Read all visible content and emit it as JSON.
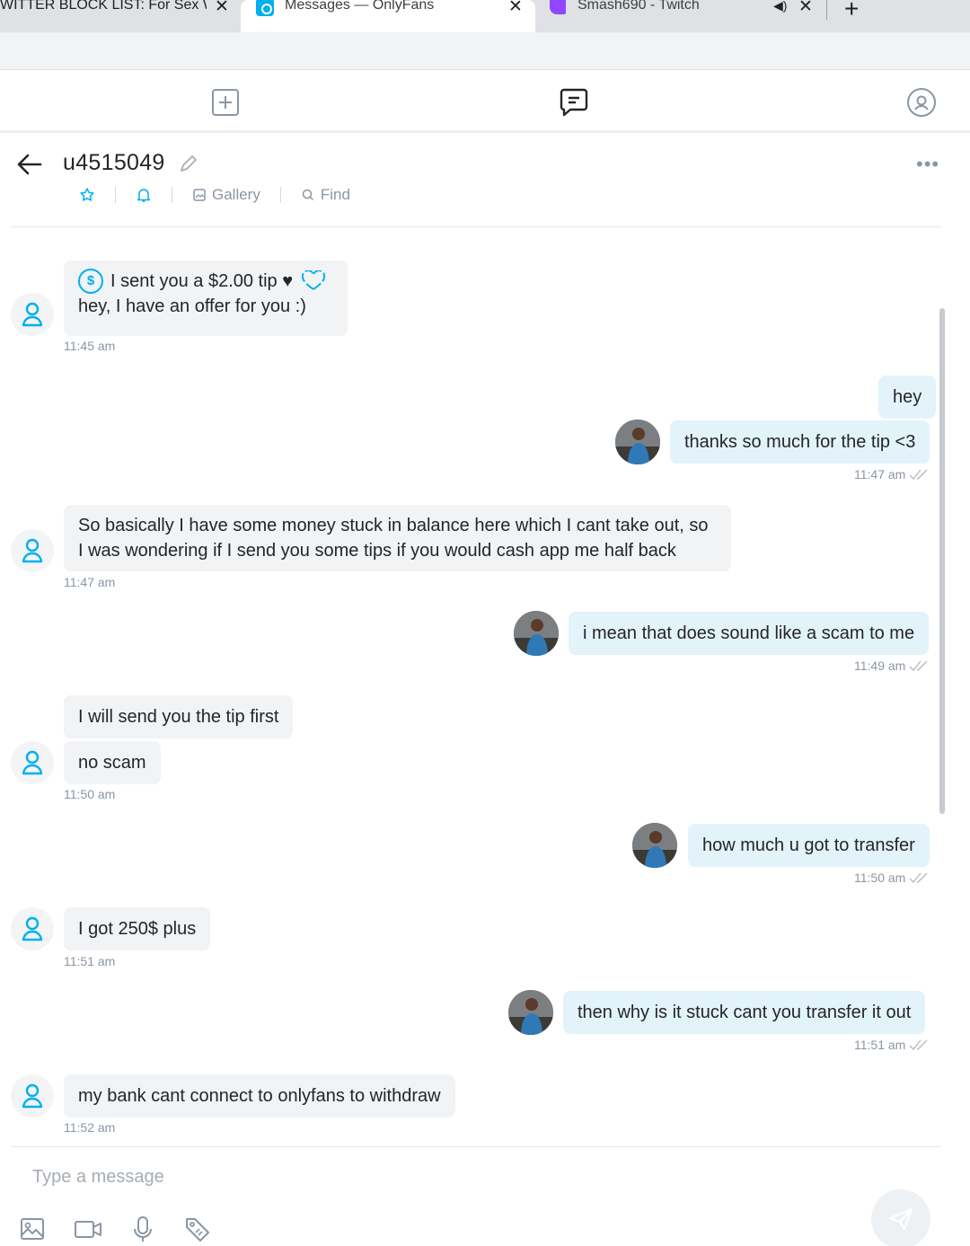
{
  "browser": {
    "tabs": [
      {
        "title": "WITTER BLOCK LIST: For Sex Wo"
      },
      {
        "title": "Messages — OnlyFans"
      },
      {
        "title": "Smash690 - Twitch"
      }
    ],
    "new_tab": "+"
  },
  "app_nav": {
    "icons": [
      "plus-square-icon",
      "chat-icon",
      "profile-icon"
    ]
  },
  "conversation": {
    "username": "u4515049",
    "more": "•••",
    "gallery_label": "Gallery",
    "find_label": "Find"
  },
  "messages": [
    {
      "side": "in",
      "tip": "I sent you a $2.00 tip ♥",
      "text": "hey, I have an offer for you :)",
      "time": "11:45 am"
    },
    {
      "side": "out",
      "text": "hey"
    },
    {
      "side": "out",
      "text": "thanks so much for the tip <3",
      "time": "11:47 am"
    },
    {
      "side": "in",
      "text_lines": [
        "So basically I have some money stuck in balance here which I cant take out, so",
        "I was wondering if I send you some tips if you would cash app me half back"
      ],
      "time": "11:47 am"
    },
    {
      "side": "out",
      "text": "i mean that does sound like a scam to me",
      "time": "11:49 am"
    },
    {
      "side": "in",
      "text": "I will send you the tip first"
    },
    {
      "side": "in",
      "text": "no scam",
      "time": "11:50 am"
    },
    {
      "side": "out",
      "text": "how much u got to transfer",
      "time": "11:50 am"
    },
    {
      "side": "in",
      "text": "I got 250$ plus",
      "time": "11:51 am"
    },
    {
      "side": "out",
      "text": "then why is it stuck cant you transfer it out",
      "time": "11:51 am"
    },
    {
      "side": "in",
      "text": "my bank cant connect to onlyfans to withdraw",
      "time": "11:52 am"
    }
  ],
  "composer": {
    "placeholder": "Type a message"
  },
  "colors": {
    "accent": "#00aff0",
    "incoming_bubble": "#f1f3f5",
    "outgoing_bubble": "#e3f3fa",
    "muted_text": "#8a96a3"
  }
}
